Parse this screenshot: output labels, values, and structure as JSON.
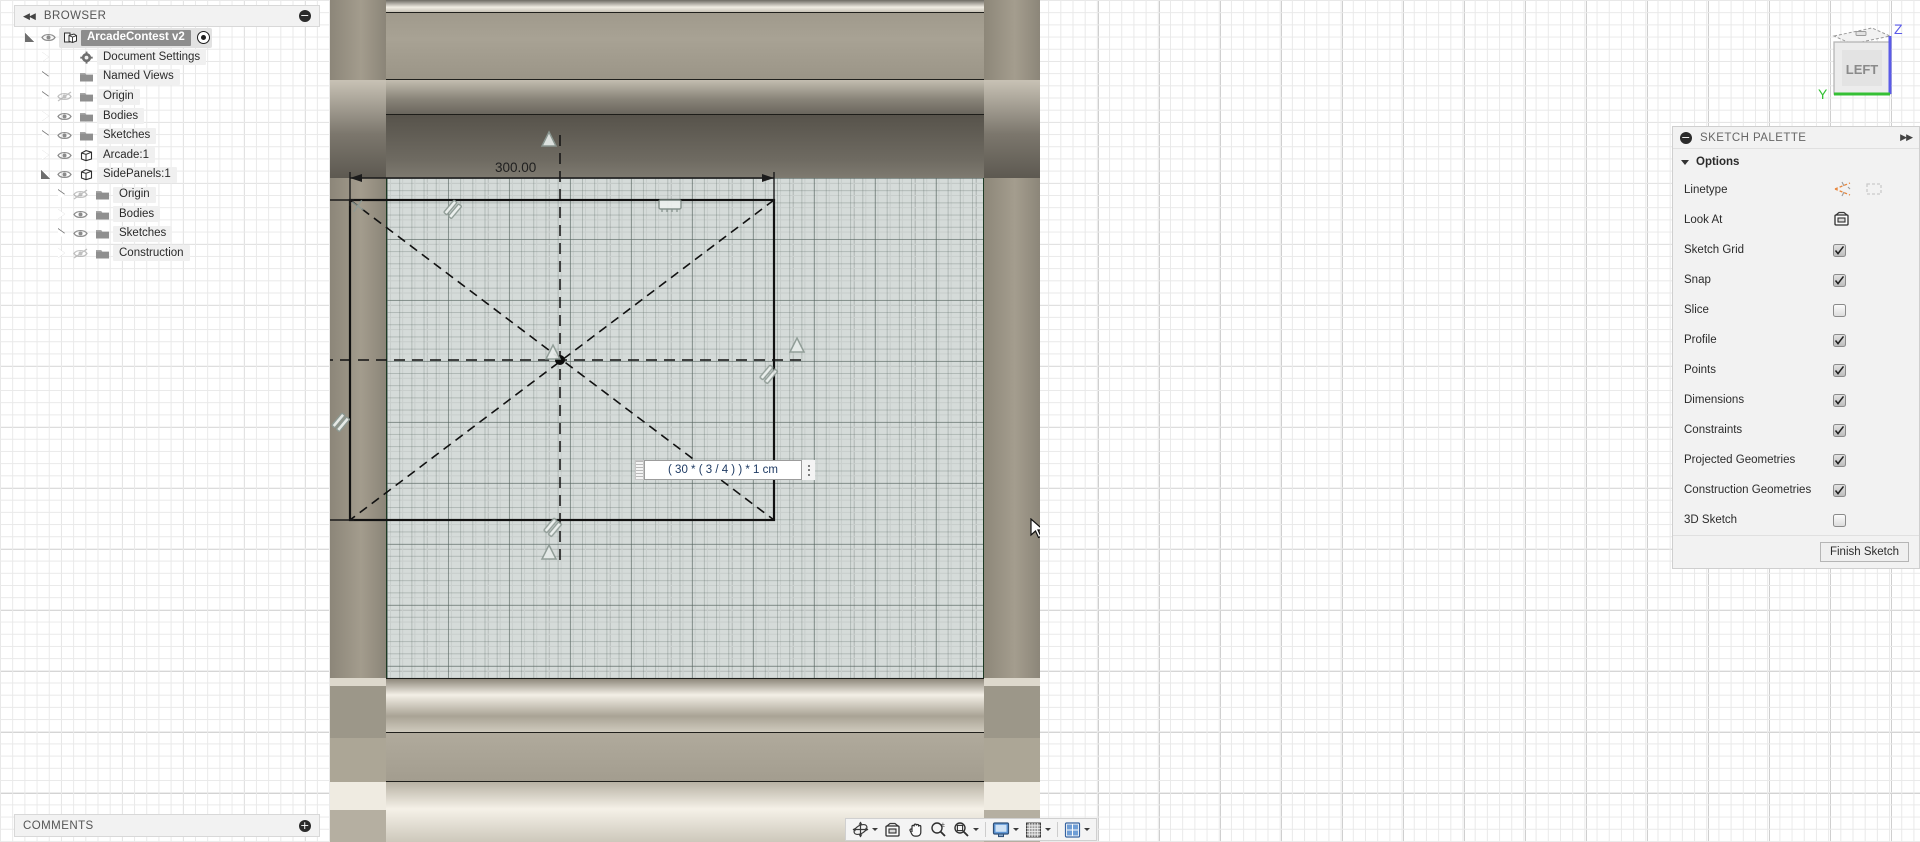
{
  "browser": {
    "header": {
      "title": "BROWSER",
      "collapse_icon": "double-left-arrow-icon",
      "minimize_icon": "minus-circle-icon"
    },
    "items": [
      {
        "label": "ArcadeContest v2",
        "depth": 0,
        "expander": "open",
        "icon": "document-icon",
        "eye": "visible",
        "selected": true,
        "radio": true
      },
      {
        "label": "Document Settings",
        "depth": 1,
        "expander": "closed",
        "icon": "gear-icon",
        "eye": "none",
        "selected": false,
        "radio": false
      },
      {
        "label": "Named Views",
        "depth": 1,
        "expander": "closed",
        "icon": "folder-icon",
        "eye": "none",
        "selected": false,
        "radio": false
      },
      {
        "label": "Origin",
        "depth": 1,
        "expander": "closed",
        "icon": "folder-icon",
        "eye": "hidden",
        "selected": false,
        "radio": false
      },
      {
        "label": "Bodies",
        "depth": 1,
        "expander": "closed",
        "icon": "folder-icon",
        "eye": "visible",
        "selected": false,
        "radio": false
      },
      {
        "label": "Sketches",
        "depth": 1,
        "expander": "closed",
        "icon": "folder-icon",
        "eye": "visible",
        "selected": false,
        "radio": false
      },
      {
        "label": "Arcade:1",
        "depth": 1,
        "expander": "closed",
        "icon": "component-icon",
        "eye": "visible",
        "selected": false,
        "radio": false
      },
      {
        "label": "SidePanels:1",
        "depth": 1,
        "expander": "open",
        "icon": "component-icon",
        "eye": "visible",
        "selected": false,
        "radio": false
      },
      {
        "label": "Origin",
        "depth": 2,
        "expander": "closed",
        "icon": "folder-icon",
        "eye": "hidden",
        "selected": false,
        "radio": false
      },
      {
        "label": "Bodies",
        "depth": 2,
        "expander": "closed",
        "icon": "folder-icon",
        "eye": "visible",
        "selected": false,
        "radio": false
      },
      {
        "label": "Sketches",
        "depth": 2,
        "expander": "closed",
        "icon": "folder-icon",
        "eye": "visible",
        "selected": false,
        "radio": false
      },
      {
        "label": "Construction",
        "depth": 2,
        "expander": "closed",
        "icon": "folder-icon",
        "eye": "hidden",
        "selected": false,
        "radio": false
      }
    ]
  },
  "comments": {
    "title": "COMMENTS",
    "add_icon": "plus-circle-icon"
  },
  "viewport": {
    "dimension_label": "300.00",
    "dimension_input": {
      "value": "( 30 * ( 3 / 4 ) ) * 1 cm",
      "grip_icon": "drag-grip-icon",
      "menu_icon": "three-dots-icon"
    },
    "constraint_glyphs": [
      "coincident-icon",
      "parallel-icon",
      "fix-ground-icon",
      "horizontal-icon"
    ],
    "cursor_icon": "mouse-pointer-icon"
  },
  "viewcube": {
    "face_label": "LEFT",
    "axis_z": "Z",
    "axis_y": "Y",
    "axis_z_color": "#5b5be8",
    "axis_y_color": "#35c035"
  },
  "navbar": {
    "items": [
      {
        "name": "orbit",
        "icon": "orbit-icon",
        "caret": true
      },
      {
        "name": "look-at",
        "icon": "look-at-icon",
        "caret": false
      },
      {
        "name": "pan",
        "icon": "pan-hand-icon",
        "caret": false
      },
      {
        "name": "zoom",
        "icon": "zoom-magnifier-icon",
        "caret": false
      },
      {
        "name": "fit",
        "icon": "fit-magnifier-icon",
        "caret": true
      },
      {
        "name": "display-settings",
        "icon": "monitor-icon",
        "caret": true
      },
      {
        "name": "grid-and-snaps",
        "icon": "grid-icon",
        "caret": true
      },
      {
        "name": "viewport-layout",
        "icon": "viewport-layout-icon",
        "caret": true
      }
    ]
  },
  "sketch_palette": {
    "header": {
      "title": "SKETCH PALETTE",
      "minimize_icon": "minus-circle-icon",
      "expand_icon": "double-right-arrow-icon"
    },
    "section": {
      "title": "Options",
      "expander_icon": "triangle-down-icon"
    },
    "options": [
      {
        "label": "Linetype",
        "type": "icons",
        "icons": [
          "construction-line-icon",
          "centerline-icon"
        ],
        "construction_color": "#e8863c"
      },
      {
        "label": "Look At",
        "type": "icon",
        "icons": [
          "look-at-icon"
        ]
      },
      {
        "label": "Sketch Grid",
        "type": "checkbox",
        "checked": true
      },
      {
        "label": "Snap",
        "type": "checkbox",
        "checked": true
      },
      {
        "label": "Slice",
        "type": "checkbox",
        "checked": false
      },
      {
        "label": "Profile",
        "type": "checkbox",
        "checked": true
      },
      {
        "label": "Points",
        "type": "checkbox",
        "checked": true
      },
      {
        "label": "Dimensions",
        "type": "checkbox",
        "checked": true
      },
      {
        "label": "Constraints",
        "type": "checkbox",
        "checked": true
      },
      {
        "label": "Projected Geometries",
        "type": "checkbox",
        "checked": true
      },
      {
        "label": "Construction Geometries",
        "type": "checkbox",
        "checked": true
      },
      {
        "label": "3D Sketch",
        "type": "checkbox",
        "checked": false
      }
    ],
    "finish_button": "Finish Sketch"
  }
}
